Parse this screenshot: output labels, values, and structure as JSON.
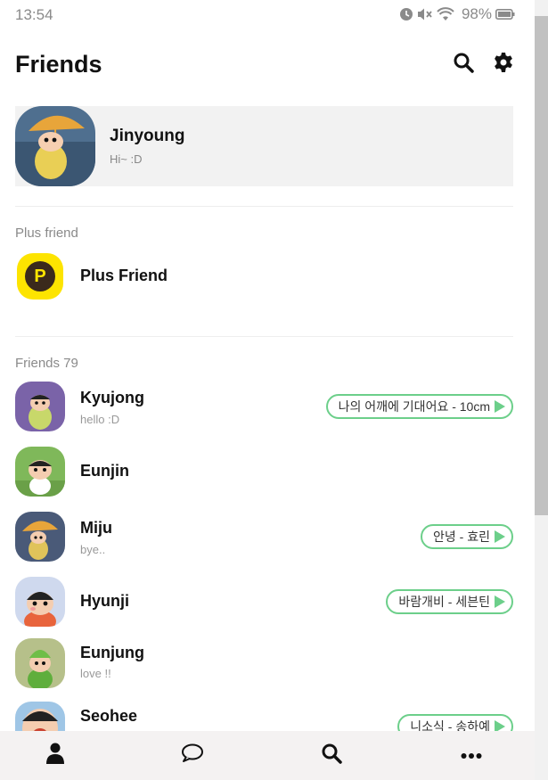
{
  "status_bar": {
    "time": "13:54",
    "battery": "98%",
    "icons": [
      "alarm-icon",
      "mute-icon",
      "wifi-icon",
      "battery-icon"
    ]
  },
  "header": {
    "title": "Friends",
    "icons": [
      "search-icon",
      "gear-icon"
    ]
  },
  "profile": {
    "name": "Jinyoung",
    "status": "Hi~ :D"
  },
  "plus_section": {
    "label": "Plus friend",
    "item_name": "Plus Friend",
    "logo_letter": "P"
  },
  "friends_section": {
    "label": "Friends 79",
    "items": [
      {
        "name": "Kyujong",
        "status": "hello :D",
        "music": "나의 어깨에 기대어요 - 10cm"
      },
      {
        "name": "Eunjin",
        "status": "",
        "music": ""
      },
      {
        "name": "Miju",
        "status": "bye..",
        "music": "안녕 - 효린"
      },
      {
        "name": "Hyunji",
        "status": "",
        "music": "바람개비 - 세븐틴"
      },
      {
        "name": "Eunjung",
        "status": "love !!",
        "music": ""
      },
      {
        "name": "Seohee",
        "status": "",
        "music": "니소식 - 송하예"
      }
    ]
  },
  "bottom_nav": {
    "items": [
      "person-icon",
      "chat-icon",
      "search-icon",
      "more-icon"
    ]
  },
  "colors": {
    "accent_green": "#6ccf8a",
    "plus_yellow": "#fde400",
    "nav_bg": "#f4f2f2"
  }
}
